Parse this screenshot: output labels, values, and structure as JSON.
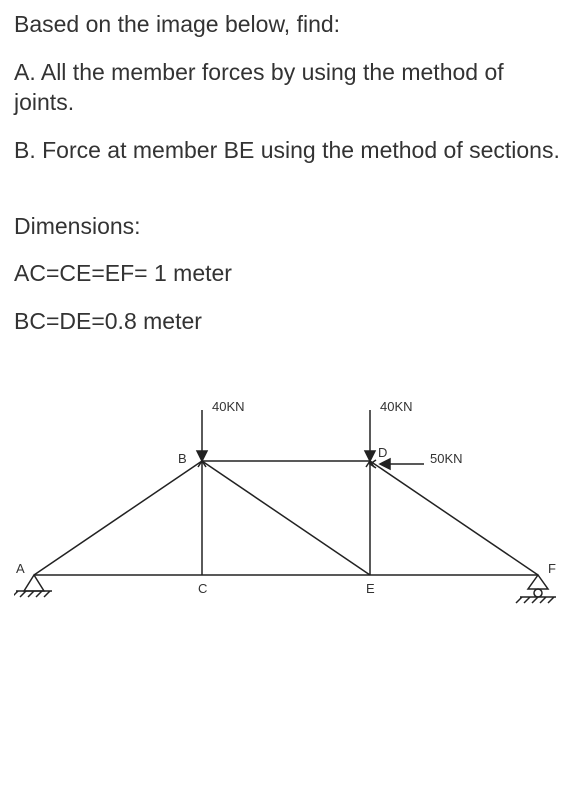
{
  "intro": "Based on the image below, find:",
  "partA": "A. All the member forces by using the method of joints.",
  "partB": "B. Force at member BE using the method of sections.",
  "dim_heading": "Dimensions:",
  "dim1": "AC=CE=EF= 1 meter",
  "dim2": "BC=DE=0.8 meter",
  "labels": {
    "A": "A",
    "B": "B",
    "C": "C",
    "D": "D",
    "E": "E",
    "F": "F",
    "load_B": "40KN",
    "load_D": "40KN",
    "load_H": "50KN"
  }
}
